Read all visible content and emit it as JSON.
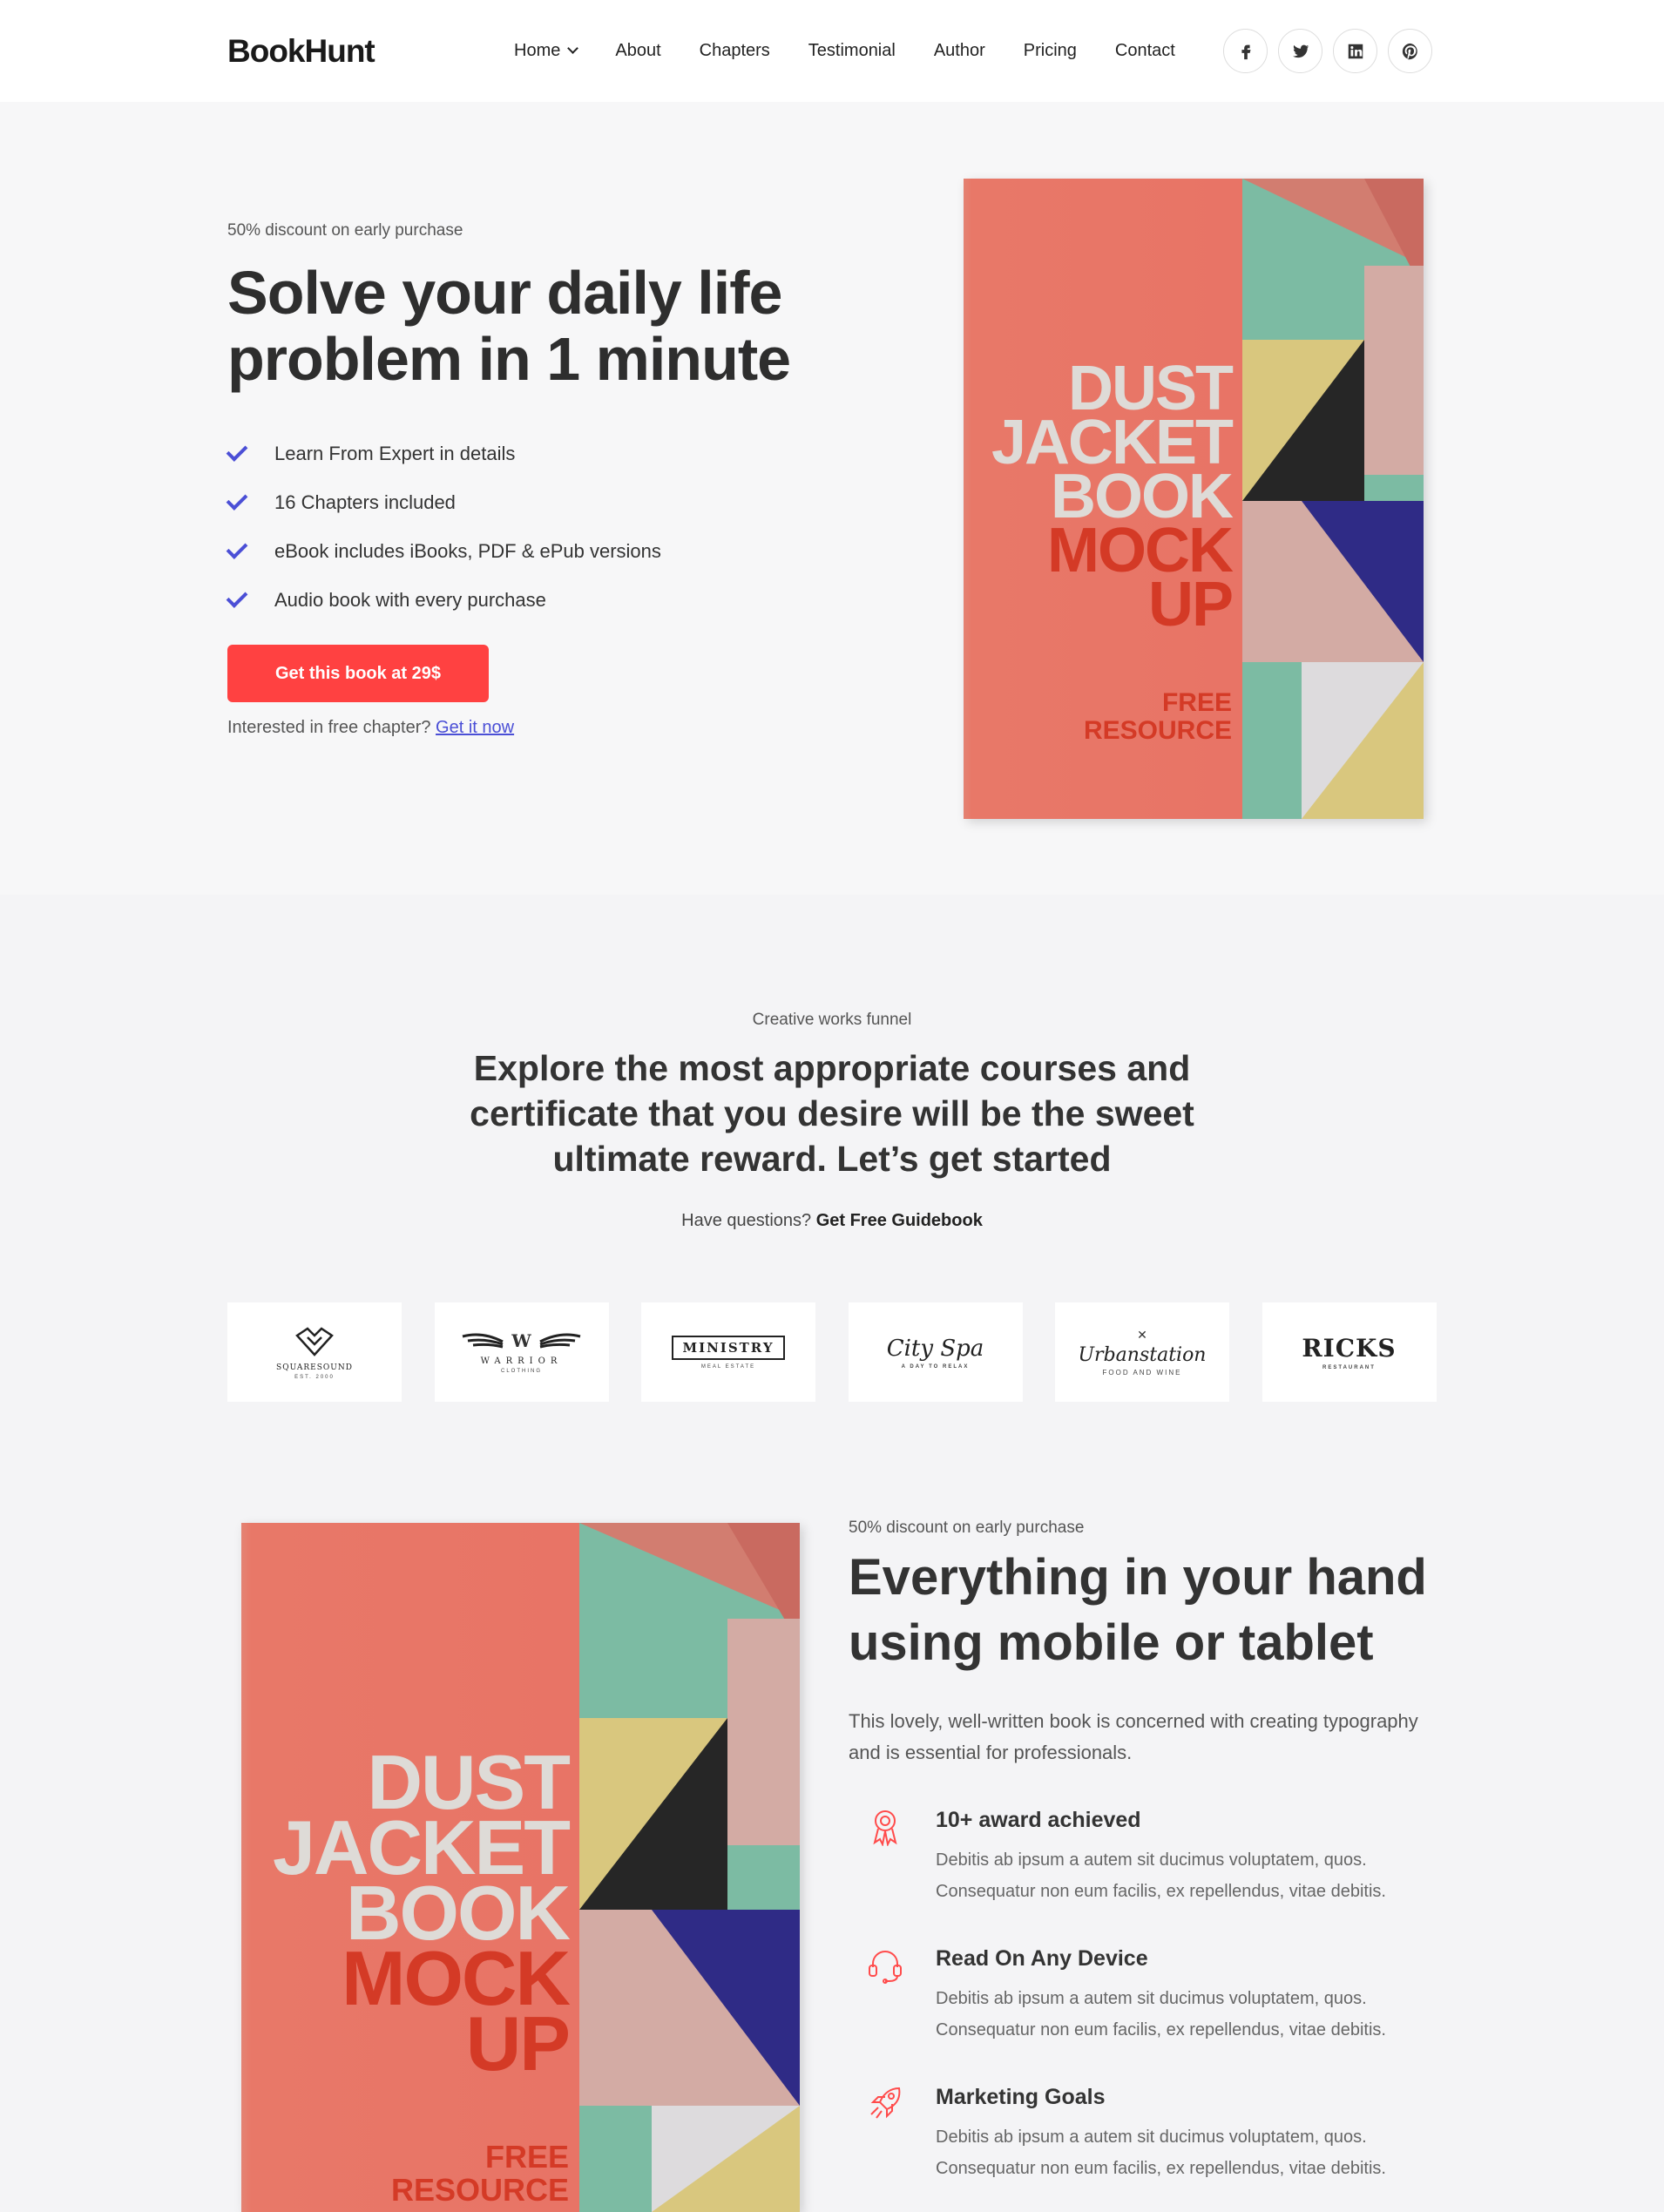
{
  "brand": "BookHunt",
  "nav": [
    {
      "label": "Home",
      "dropdown": true
    },
    {
      "label": "About"
    },
    {
      "label": "Chapters"
    },
    {
      "label": "Testimonial"
    },
    {
      "label": "Author"
    },
    {
      "label": "Pricing"
    },
    {
      "label": "Contact"
    }
  ],
  "socials": [
    "facebook-icon",
    "twitter-icon",
    "linkedin-icon",
    "pinterest-icon"
  ],
  "hero": {
    "eyebrow": "50% discount on early purchase",
    "title": "Solve your daily life problem in 1 minute",
    "features": [
      "Learn From Expert in details",
      "16 Chapters included",
      "eBook includes iBooks, PDF & ePub versions",
      "Audio book with every purchase"
    ],
    "cta": "Get this book at 29$",
    "free_text": "Interested in free chapter?",
    "free_link": "Get it now"
  },
  "book": {
    "line1": "DUST",
    "line2": "JACKET",
    "line3": "BOOK",
    "line4": "MOCK",
    "line5": "UP",
    "small1": "FREE",
    "small2": "RESOURCE"
  },
  "funnel": {
    "eyebrow": "Creative works funnel",
    "title": "Explore the most appropriate courses and certificate that you desire will be the sweet ultimate reward. Let’s get started",
    "question": "Have questions?",
    "question_link": "Get Free Guidebook"
  },
  "partners": [
    {
      "name": "SQUARESOUND",
      "sub": "EST. 2000"
    },
    {
      "name": "WARRIOR",
      "sub": "CLOTHING"
    },
    {
      "name": "MINISTRY",
      "sub": "MEAL ESTATE"
    },
    {
      "name": "City Spa",
      "sub": "A DAY TO RELAX"
    },
    {
      "name": "Urbanstation",
      "sub": "FOOD AND WINE"
    },
    {
      "name": "RICKS",
      "sub": "RESTAURANT"
    }
  ],
  "mobile": {
    "eyebrow": "50% discount on early purchase",
    "title": "Everything in your hand using mobile or tablet",
    "desc": "This lovely, well-written book is concerned with creating typography and is essential for professionals.",
    "items": [
      {
        "icon": "award-icon",
        "title": "10+ award achieved",
        "text": "Debitis ab ipsum a autem sit ducimus voluptatem, quos. Consequatur non eum facilis, ex repellendus, vitae debitis."
      },
      {
        "icon": "headset-icon",
        "title": "Read On Any Device",
        "text": "Debitis ab ipsum a autem sit ducimus voluptatem, quos. Consequatur non eum facilis, ex repellendus, vitae debitis."
      },
      {
        "icon": "rocket-icon",
        "title": "Marketing Goals",
        "text": "Debitis ab ipsum a autem sit ducimus voluptatem, quos. Consequatur non eum facilis, ex repellendus, vitae debitis."
      }
    ]
  },
  "colors": {
    "accent": "#ff4141",
    "check": "#4b4fd6",
    "book_red": "#e87466"
  }
}
